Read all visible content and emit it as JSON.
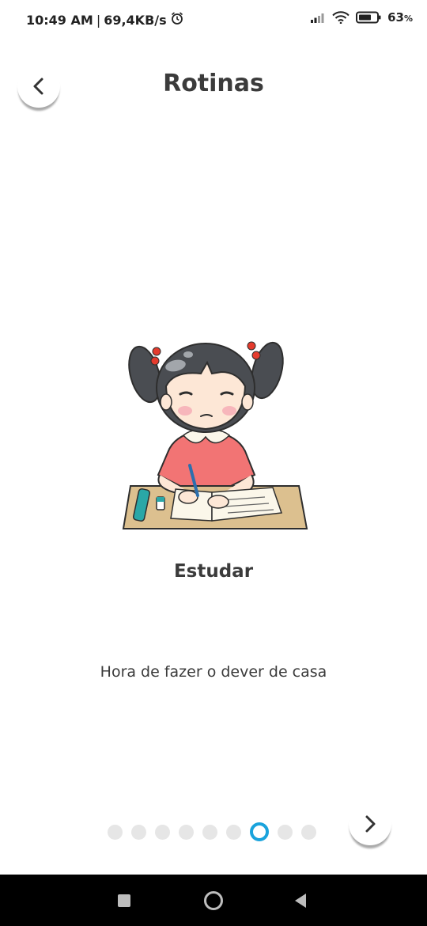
{
  "status_bar": {
    "time": "10:49 AM",
    "separator": "|",
    "speed": "69,4KB/s",
    "battery_value": "63",
    "battery_unit": "%",
    "icons": [
      "alarm-icon",
      "signal-icon",
      "wifi-icon",
      "battery-icon"
    ]
  },
  "header": {
    "title": "Rotinas",
    "back_icon": "chevron-left-icon"
  },
  "routine": {
    "title": "Estudar",
    "description": "Hora de fazer o dever de casa",
    "illustration": "girl-studying-illustration"
  },
  "pager": {
    "total": 9,
    "active_index": 6,
    "next_icon": "chevron-right-icon",
    "active_color": "#1aa3dc",
    "inactive_color": "#e6e6e6"
  },
  "system_nav": {
    "icons": [
      "recent-apps-icon",
      "home-icon",
      "back-icon"
    ]
  }
}
